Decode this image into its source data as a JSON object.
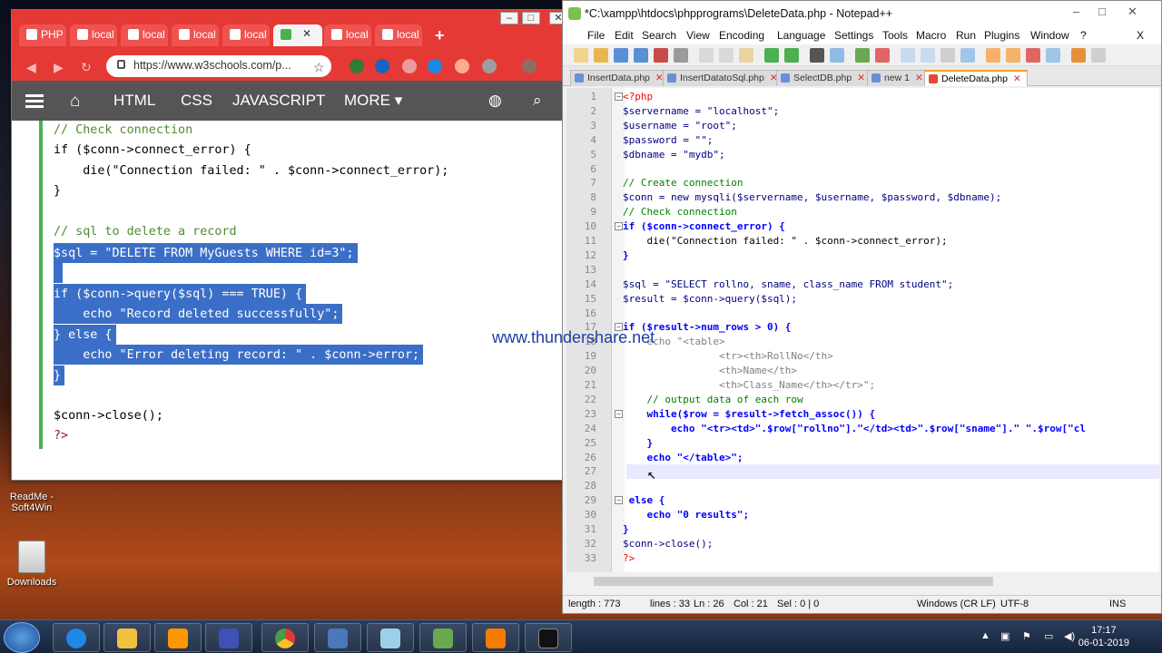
{
  "desktop": {
    "icons": [
      {
        "label": "ReadMe - Soft4Win"
      },
      {
        "label": "Downloads"
      }
    ]
  },
  "browser": {
    "tabs": [
      {
        "label": "PHP"
      },
      {
        "label": "local"
      },
      {
        "label": "local"
      },
      {
        "label": "local"
      },
      {
        "label": "local"
      },
      {
        "label": ""
      },
      {
        "label": "local"
      },
      {
        "label": "local"
      }
    ],
    "url": "https://www.w3schools.com/p...",
    "nav": [
      "HTML",
      "CSS",
      "JAVASCRIPT",
      "MORE ▾"
    ],
    "code": {
      "lines": [
        {
          "text": "// Check connection"
        },
        {
          "text": "if ($conn->connect_error) {"
        },
        {
          "text": "    die(\"Connection failed: \" . $conn->connect_error);"
        },
        {
          "text": "}"
        },
        {
          "text": ""
        },
        {
          "text": "// sql to delete a record"
        },
        {
          "text": "$sql = \"DELETE FROM MyGuests WHERE id=3\";"
        },
        {
          "text": ""
        },
        {
          "text": "if ($conn->query($sql) === TRUE) {"
        },
        {
          "text": "    echo \"Record deleted successfully\";"
        },
        {
          "text": "} else {"
        },
        {
          "text": "    echo \"Error deleting record: \" . $conn->error;"
        },
        {
          "text": "}"
        },
        {
          "text": ""
        },
        {
          "text": "$conn->close();"
        },
        {
          "text": "?>"
        }
      ]
    }
  },
  "watermark": "www.thundershare.net",
  "notepad": {
    "title": "*C:\\xampp\\htdocs\\phpprograms\\DeleteData.php - Notepad++",
    "menu": [
      "File",
      "Edit",
      "Search",
      "View",
      "Encoding",
      "Language",
      "Settings",
      "Tools",
      "Macro",
      "Run",
      "Plugins",
      "Window",
      "?"
    ],
    "close_x": "X",
    "tabs": [
      "InsertData.php",
      "InsertDatatoSql.php",
      "SelectDB.php",
      "new 1",
      "DeleteData.php"
    ],
    "lines": [
      "<?php",
      "$servername = \"localhost\";",
      "$username = \"root\";",
      "$password = \"\";",
      "$dbname = \"mydb\";",
      "",
      "// Create connection",
      "$conn = new mysqli($servername, $username, $password, $dbname);",
      "// Check connection",
      "if ($conn->connect_error) {",
      "    die(\"Connection failed: \" . $conn->connect_error);",
      "}",
      "",
      "$sql = \"SELECT rollno, sname, class_name FROM student\";",
      "$result = $conn->query($sql);",
      "",
      "if ($result->num_rows > 0) {",
      "    echo \"<table>",
      "                <tr><th>RollNo</th>",
      "                <th>Name</th>",
      "                <th>Class_Name</th></tr>\";",
      "    // output data of each row",
      "    while($row = $result->fetch_assoc()) {",
      "        echo \"<tr><td>\".$row[\"rollno\"].\"</td><td>\".$row[\"sname\"].\" \".$row[\"cl",
      "    }",
      "    echo \"</table>\";",
      "",
      "",
      " else {",
      "    echo \"0 results\";",
      "}",
      "$conn->close();",
      "?>"
    ],
    "status": {
      "length": "length : 773",
      "lines": "lines : 33",
      "ln": "Ln : 26",
      "col": "Col : 21",
      "sel": "Sel : 0 | 0",
      "eol": "Windows (CR LF)",
      "encoding": "UTF-8",
      "mode": "INS"
    }
  },
  "taskbar": {
    "time": "17:17",
    "date": "06-01-2019"
  }
}
